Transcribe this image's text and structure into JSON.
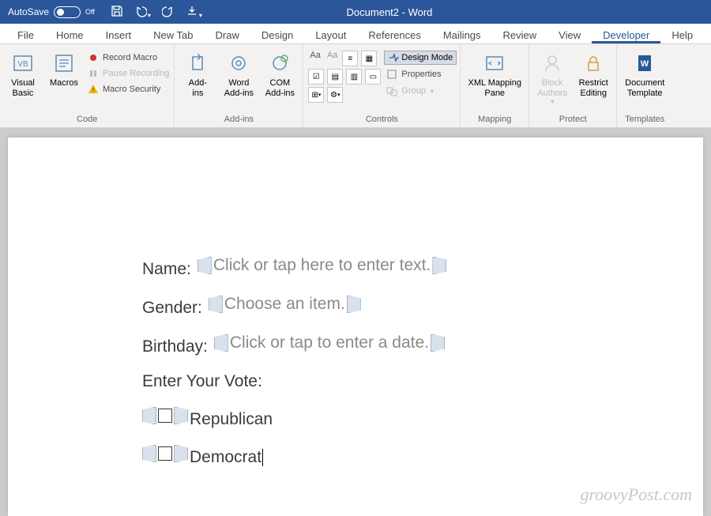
{
  "titlebar": {
    "autosave": "AutoSave",
    "autosave_state": "Off",
    "title": "Document2 - Word"
  },
  "tabs": [
    "File",
    "Home",
    "Insert",
    "New Tab",
    "Draw",
    "Design",
    "Layout",
    "References",
    "Mailings",
    "Review",
    "View",
    "Developer",
    "Help"
  ],
  "active_tab": "Developer",
  "ribbon": {
    "code": {
      "label": "Code",
      "visual_basic": "Visual\nBasic",
      "macros": "Macros",
      "record": "Record Macro",
      "pause": "Pause Recording",
      "security": "Macro Security"
    },
    "addins": {
      "label": "Add-ins",
      "addins": "Add-\nins",
      "word": "Word\nAdd-ins",
      "com": "COM\nAdd-ins"
    },
    "controls": {
      "label": "Controls",
      "design_mode": "Design Mode",
      "properties": "Properties",
      "group": "Group"
    },
    "mapping": {
      "label": "Mapping",
      "xml": "XML Mapping\nPane"
    },
    "protect": {
      "label": "Protect",
      "block": "Block\nAuthors",
      "restrict": "Restrict\nEditing"
    },
    "templates": {
      "label": "Templates",
      "doc": "Document\nTemplate"
    }
  },
  "doc": {
    "name_label": "Name:",
    "name_ph": "Click or tap here to enter text.",
    "gender_label": "Gender:",
    "gender_ph": "Choose an item.",
    "bday_label": "Birthday:",
    "bday_ph": "Click or tap to enter a date.",
    "vote_label": "Enter Your Vote:",
    "opt1": "Republican",
    "opt2": "Democrat"
  },
  "watermark": "groovyPost.com"
}
